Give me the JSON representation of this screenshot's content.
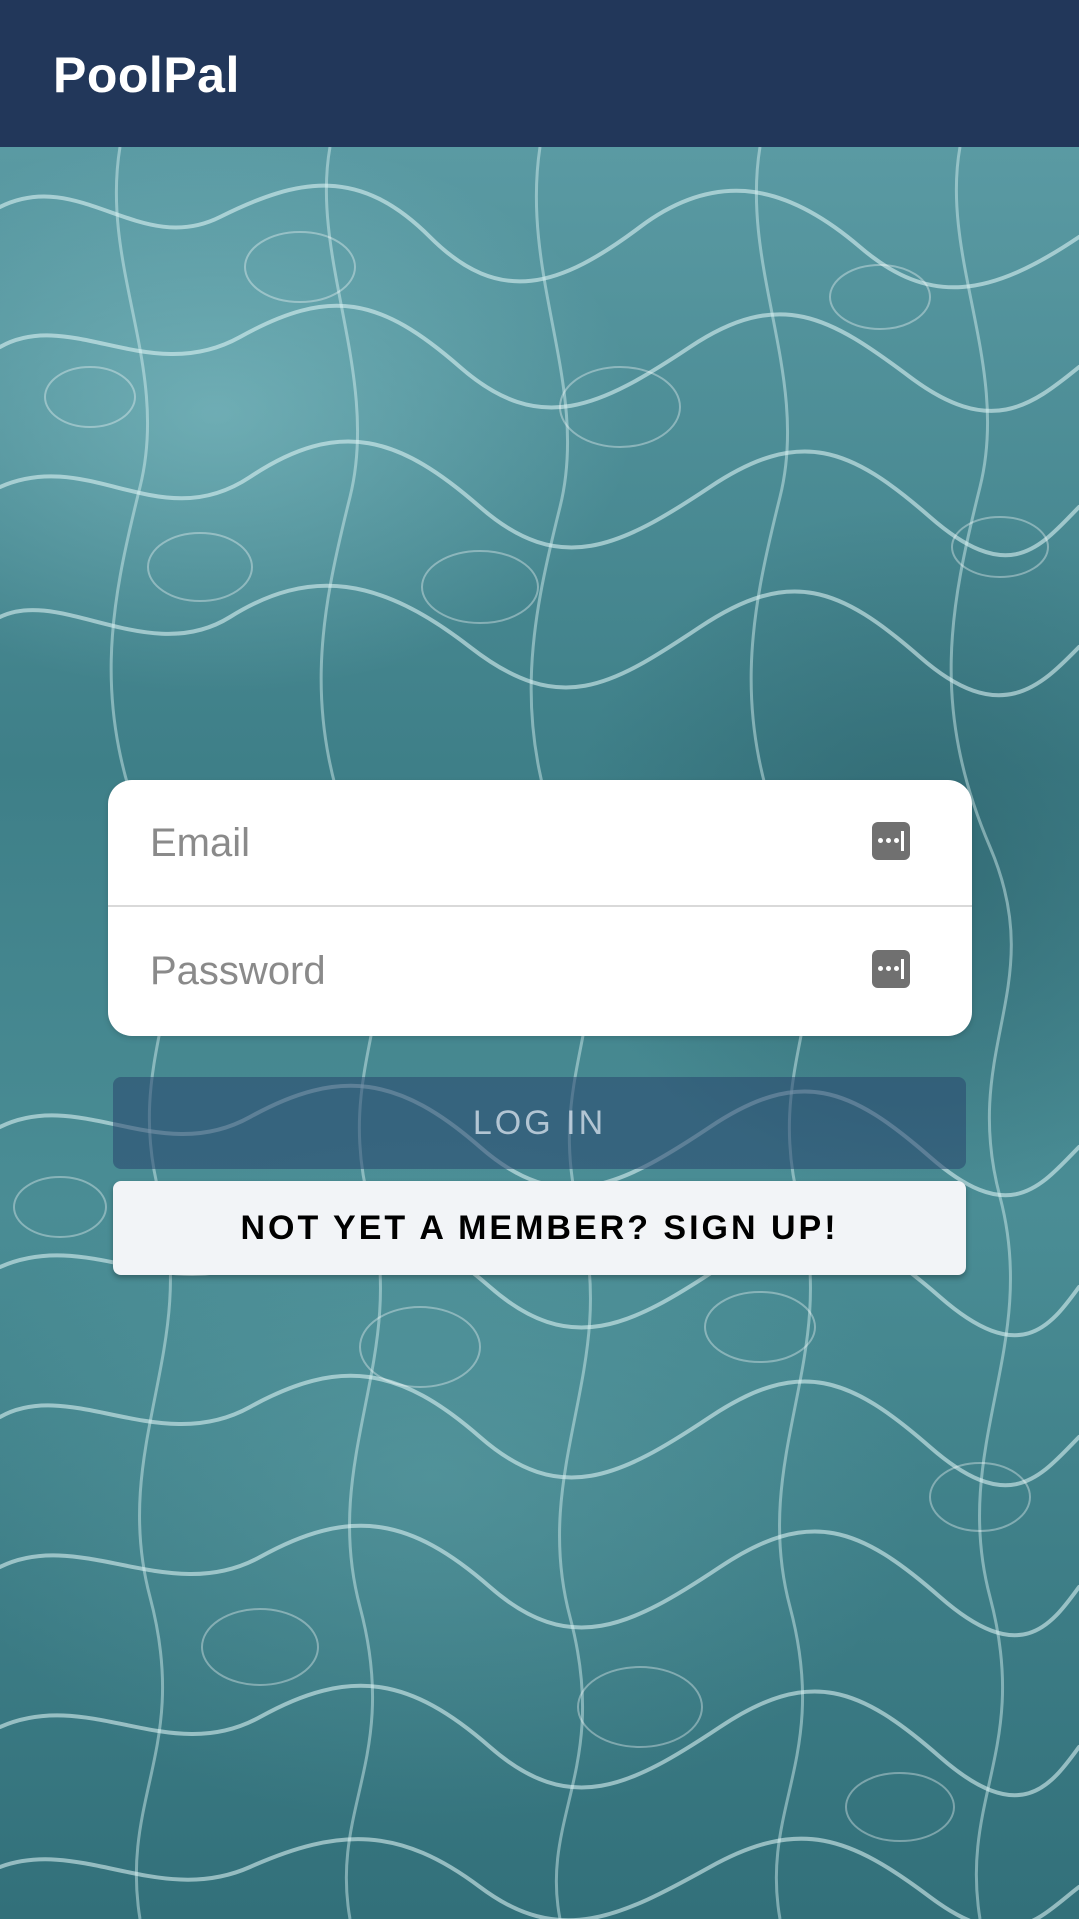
{
  "header": {
    "title": "PoolPal",
    "background": "#22375a"
  },
  "background": {
    "description_icon": "water-ripple-background"
  },
  "form": {
    "email": {
      "placeholder": "Email",
      "value": "",
      "icon": "password-key-icon"
    },
    "password": {
      "placeholder": "Password",
      "value": "",
      "icon": "password-key-icon"
    }
  },
  "actions": {
    "login_label": "LOG IN",
    "signup_label": "NOT YET A MEMBER? SIGN UP!"
  },
  "colors": {
    "accent": "#22375a",
    "card": "#ffffff",
    "signup_bg": "#f2f4f7"
  }
}
